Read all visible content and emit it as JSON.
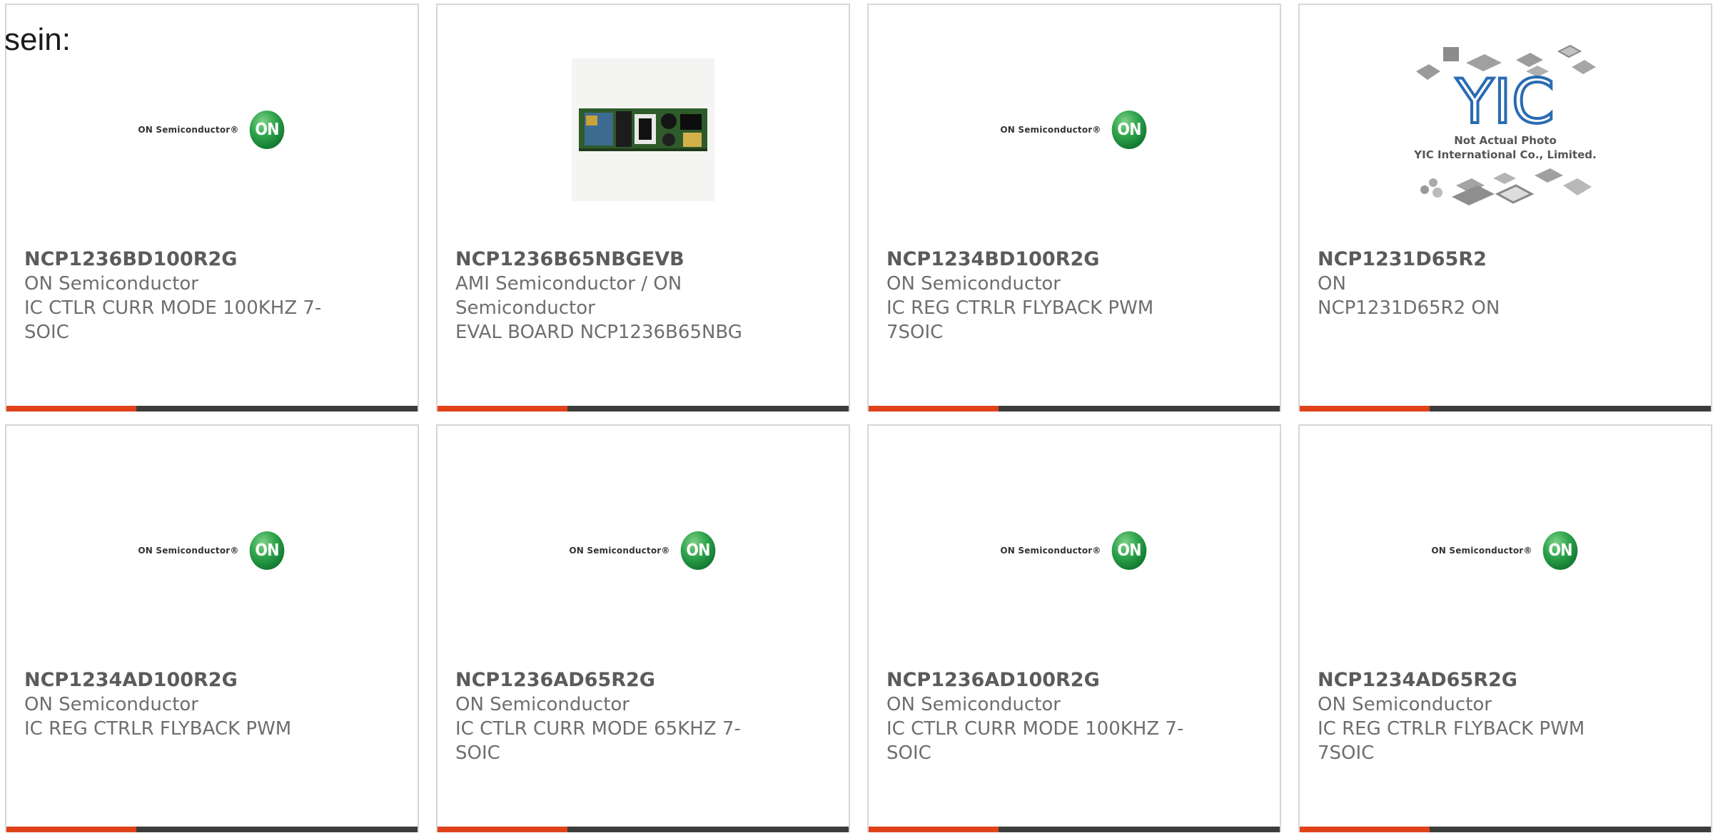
{
  "intro": {
    "text": "sein:"
  },
  "colors": {
    "accent_bar": "#e0431a",
    "rest_bar": "#3c3c3c",
    "card_border": "#d6d6d6",
    "text": "#6e6e6e"
  },
  "products": [
    {
      "part_number": "NCP1236BD100R2G",
      "manufacturer": "ON Semiconductor",
      "description": "IC CTLR CURR MODE 100KHZ 7-SOIC",
      "image_type": "on-semiconductor-logo"
    },
    {
      "part_number": "NCP1236B65NBGEVB",
      "manufacturer": "AMI Semiconductor / ON Semiconductor",
      "description": "EVAL BOARD NCP1236B65NBG",
      "image_type": "evaluation-board-photo"
    },
    {
      "part_number": "NCP1234BD100R2G",
      "manufacturer": "ON Semiconductor",
      "description": "IC REG CTRLR FLYBACK PWM 7SOIC",
      "image_type": "on-semiconductor-logo"
    },
    {
      "part_number": "NCP1231D65R2",
      "manufacturer": "ON",
      "description": "NCP1231D65R2 ON",
      "image_type": "yic-placeholder"
    },
    {
      "part_number": "NCP1234AD100R2G",
      "manufacturer": "ON Semiconductor",
      "description": "IC REG CTRLR FLYBACK PWM",
      "image_type": "on-semiconductor-logo"
    },
    {
      "part_number": "NCP1236AD65R2G",
      "manufacturer": "ON Semiconductor",
      "description": "IC CTLR CURR MODE 65KHZ 7-SOIC",
      "image_type": "on-semiconductor-logo"
    },
    {
      "part_number": "NCP1236AD100R2G",
      "manufacturer": "ON Semiconductor",
      "description": "IC CTLR CURR MODE 100KHZ 7-SOIC",
      "image_type": "on-semiconductor-logo"
    },
    {
      "part_number": "NCP1234AD65R2G",
      "manufacturer": "ON Semiconductor",
      "description": "IC REG CTRLR FLYBACK PWM 7SOIC",
      "image_type": "on-semiconductor-logo"
    }
  ],
  "on_logo": {
    "wordmark": "ON Semiconductor®",
    "badge": "ON"
  },
  "yic_placeholder": {
    "line1": "Not Actual Photo",
    "line2": "YIC International Co., Limited."
  }
}
